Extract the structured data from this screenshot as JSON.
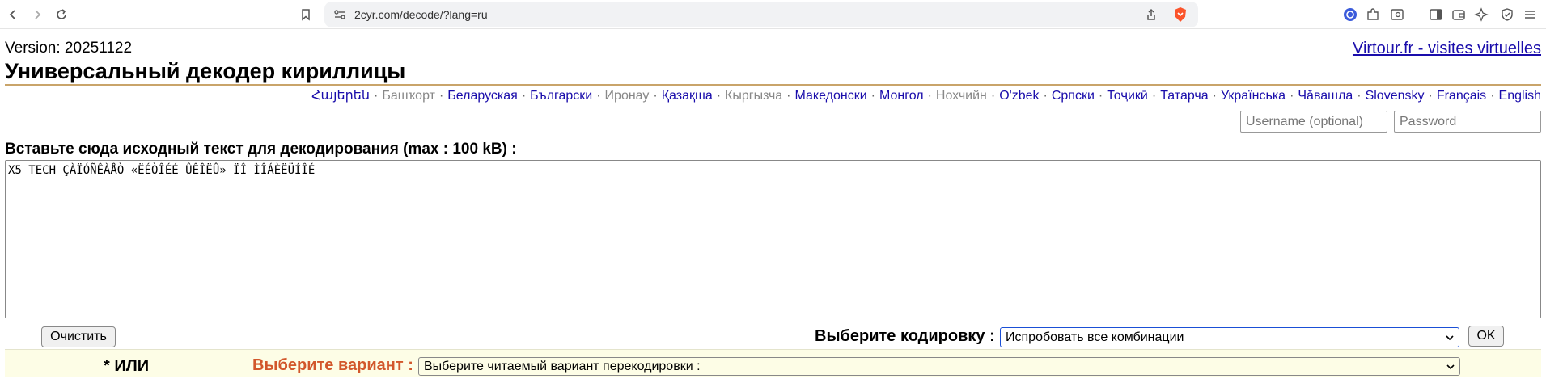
{
  "browser": {
    "url": "2cyr.com/decode/?lang=ru"
  },
  "header": {
    "version": "Version: 20251122",
    "title": "Универсальный декодер кириллицы",
    "virtour_link": "Virtour.fr - visites virtuelles"
  },
  "languages": [
    {
      "label": "Հայերեն",
      "active": true
    },
    {
      "label": "Башҡорт",
      "active": false
    },
    {
      "label": "Беларуская",
      "active": true
    },
    {
      "label": "Български",
      "active": true
    },
    {
      "label": "Иронау",
      "active": false
    },
    {
      "label": "Қазақша",
      "active": true
    },
    {
      "label": "Кыргызча",
      "active": false
    },
    {
      "label": "Македонски",
      "active": true
    },
    {
      "label": "Монгол",
      "active": true
    },
    {
      "label": "Нохчийн",
      "active": false
    },
    {
      "label": "O'zbek",
      "active": true
    },
    {
      "label": "Српски",
      "active": true
    },
    {
      "label": "Тоҷикӣ",
      "active": true
    },
    {
      "label": "Татарча",
      "active": true
    },
    {
      "label": "Українська",
      "active": true
    },
    {
      "label": "Чӑвашла",
      "active": true
    },
    {
      "label": "Slovensky",
      "active": true
    },
    {
      "label": "Français",
      "active": true
    },
    {
      "label": "English",
      "active": true
    }
  ],
  "login": {
    "username_placeholder": "Username (optional)",
    "password_placeholder": "Password"
  },
  "decoder": {
    "prompt": "Вставьте сюда исходный текст для декодирования (max : 100 kB) :",
    "source_text": "X5 TECH ÇÀÏÓÑÊÀÅÒ «ËÉÒÎÉÉ ÛÊÎËÛ» ÏÎ ÌÎÁÈËÜÍÎÉ",
    "clear_label": "Очистить",
    "encoding_label": "Выберите кодировку :",
    "encoding_selected": "Испробовать все комбинации",
    "ok_label": "OK",
    "or_label": "* ИЛИ",
    "variant_label": "Выберите вариант :",
    "variant_selected": "Выберите читаемый вариант перекодировки :"
  },
  "colors": {
    "link": "#1a0dab",
    "muted_link": "#888888",
    "variant_label": "#d2572b",
    "variant_band": "#fdfde6",
    "title_rule": "#c9a46a",
    "select_focus": "#1a4fd6"
  }
}
